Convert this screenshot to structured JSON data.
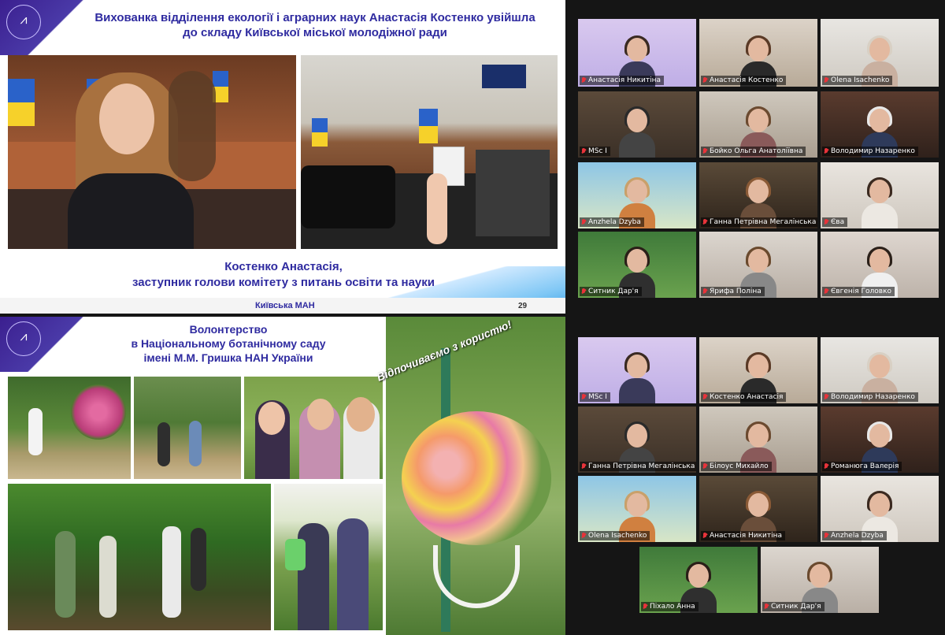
{
  "slide1": {
    "title": "Вихованка відділення екології і аграрних наук Анастасія Костенко увійшла до складу Київської міської молодіжної ради",
    "caption_name": "Костенко Анастасія,",
    "caption_role": "заступник голови комітету з питань освіти та науки",
    "footer": "Київська МАН",
    "page_number": "29"
  },
  "slide2": {
    "title_line1": "Волонтерство",
    "title_line2": "в Національному ботанічному саду",
    "title_line3": "імені М.М. Гришка НАН України",
    "side_text": "Відпочиваємо з користю!"
  },
  "logo_text": "КИЇВСЬКА МАЛА АКАДЕМІЯ НАУК",
  "gallery_top": [
    {
      "name": "Анастасія Никитіна",
      "active": true
    },
    {
      "name": "Анастасія Костенко"
    },
    {
      "name": "Olena Isachenko"
    },
    {
      "name": "MSc I"
    },
    {
      "name": "Бойко Ольга Анатоліївна"
    },
    {
      "name": "Володимир Назаренко"
    },
    {
      "name": "Anzhela Dzyba"
    },
    {
      "name": "Ганна Петрівна Мегалінська"
    },
    {
      "name": "Єва"
    },
    {
      "name": "Ситник Дар'я"
    },
    {
      "name": "Ярифа Поліна"
    },
    {
      "name": "Євгенія Головко"
    }
  ],
  "gallery_bottom": [
    {
      "name": "MSc I"
    },
    {
      "name": "Костенко Анастасія"
    },
    {
      "name": "Володимир Назаренко"
    },
    {
      "name": "Ганна Петрівна Мегалінська"
    },
    {
      "name": "Білоус Михайло"
    },
    {
      "name": "Романюга Валерія"
    },
    {
      "name": "Olena Isachenko"
    },
    {
      "name": "Анастасія Никитіна",
      "active": true
    },
    {
      "name": "Anzhela Dzyba"
    },
    {
      "name": "Піхало Анна"
    },
    {
      "name": "Ситник Дар'я"
    }
  ],
  "colors": {
    "accent": "#2f2ba0",
    "active_border": "#e4e12a",
    "mic_muted": "#e8333a"
  }
}
